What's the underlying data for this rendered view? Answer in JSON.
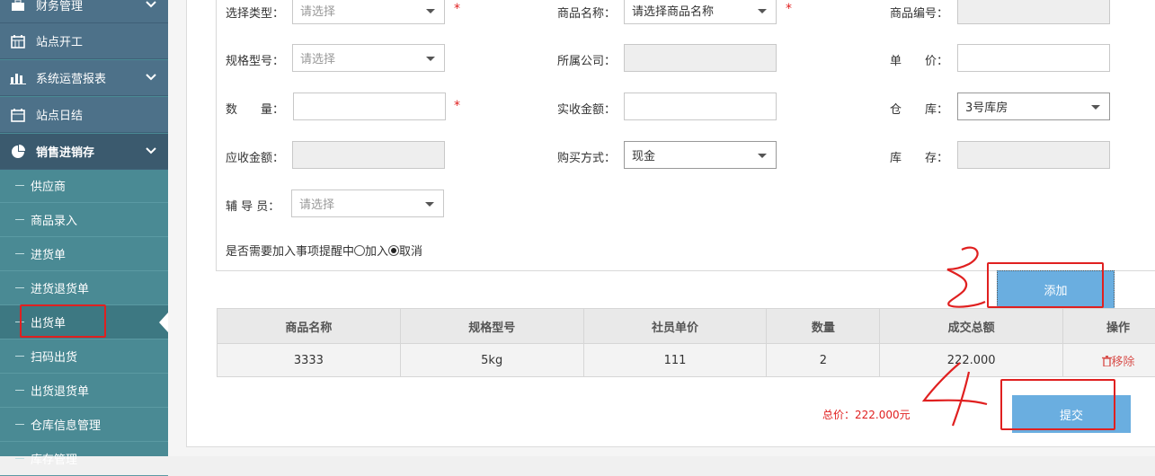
{
  "sidebar": {
    "menus": [
      {
        "label": "财务管理",
        "icon": "briefcase-icon",
        "has_chevron": true
      },
      {
        "label": "站点开工",
        "icon": "calendar-icon",
        "has_chevron": false
      },
      {
        "label": "系统运营报表",
        "icon": "bar-chart-icon",
        "has_chevron": true
      },
      {
        "label": "站点日结",
        "icon": "calendar-icon",
        "has_chevron": false
      },
      {
        "label": "销售进销存",
        "icon": "pie-chart-icon",
        "has_chevron": true
      }
    ],
    "submenu": [
      "供应商",
      "商品录入",
      "进货单",
      "进货退货单",
      "出货单",
      "扫码出货",
      "出货退货单",
      "仓库信息管理",
      "库存管理"
    ]
  },
  "form": {
    "select_type": {
      "label": "选择类型：",
      "placeholder": "请选择"
    },
    "product_name": {
      "label": "商品名称：",
      "placeholder": "请选择商品名称"
    },
    "product_code": {
      "label": "商品编号：",
      "value": ""
    },
    "spec_model": {
      "label": "规格型号：",
      "placeholder": "请选择"
    },
    "company": {
      "label": "所属公司：",
      "value": ""
    },
    "unit_price": {
      "label": "单　　价：",
      "value": ""
    },
    "quantity": {
      "label": "数　　量：",
      "value": ""
    },
    "actual_amount": {
      "label": "实收金额：",
      "value": ""
    },
    "warehouse": {
      "label": "仓　　库：",
      "value": "3号库房"
    },
    "receivable": {
      "label": "应收金额：",
      "value": ""
    },
    "payment": {
      "label": "购买方式：",
      "value": "现金"
    },
    "stock": {
      "label": "库　　存：",
      "value": ""
    },
    "assistant": {
      "label": "辅 导 员：",
      "placeholder": "请选择"
    },
    "reminder": {
      "label": "是否需要加入事项提醒中",
      "opt_add": "加入",
      "opt_cancel": "取消",
      "selected": "取消"
    },
    "required_mark": "*"
  },
  "buttons": {
    "add": "添加",
    "submit": "提交"
  },
  "table": {
    "headers": [
      "商品名称",
      "规格型号",
      "社员单价",
      "数量",
      "成交总额",
      "操作"
    ],
    "rows": [
      {
        "name": "3333",
        "spec": "5kg",
        "price": "111",
        "qty": "2",
        "total": "222.000",
        "action": "移除"
      }
    ]
  },
  "summary": {
    "total": "总价：222.000元"
  },
  "colors": {
    "sidebar": "#4a8a94",
    "menu": "#4d7189",
    "button": "#6aaee0",
    "annotation": "#e02020"
  }
}
